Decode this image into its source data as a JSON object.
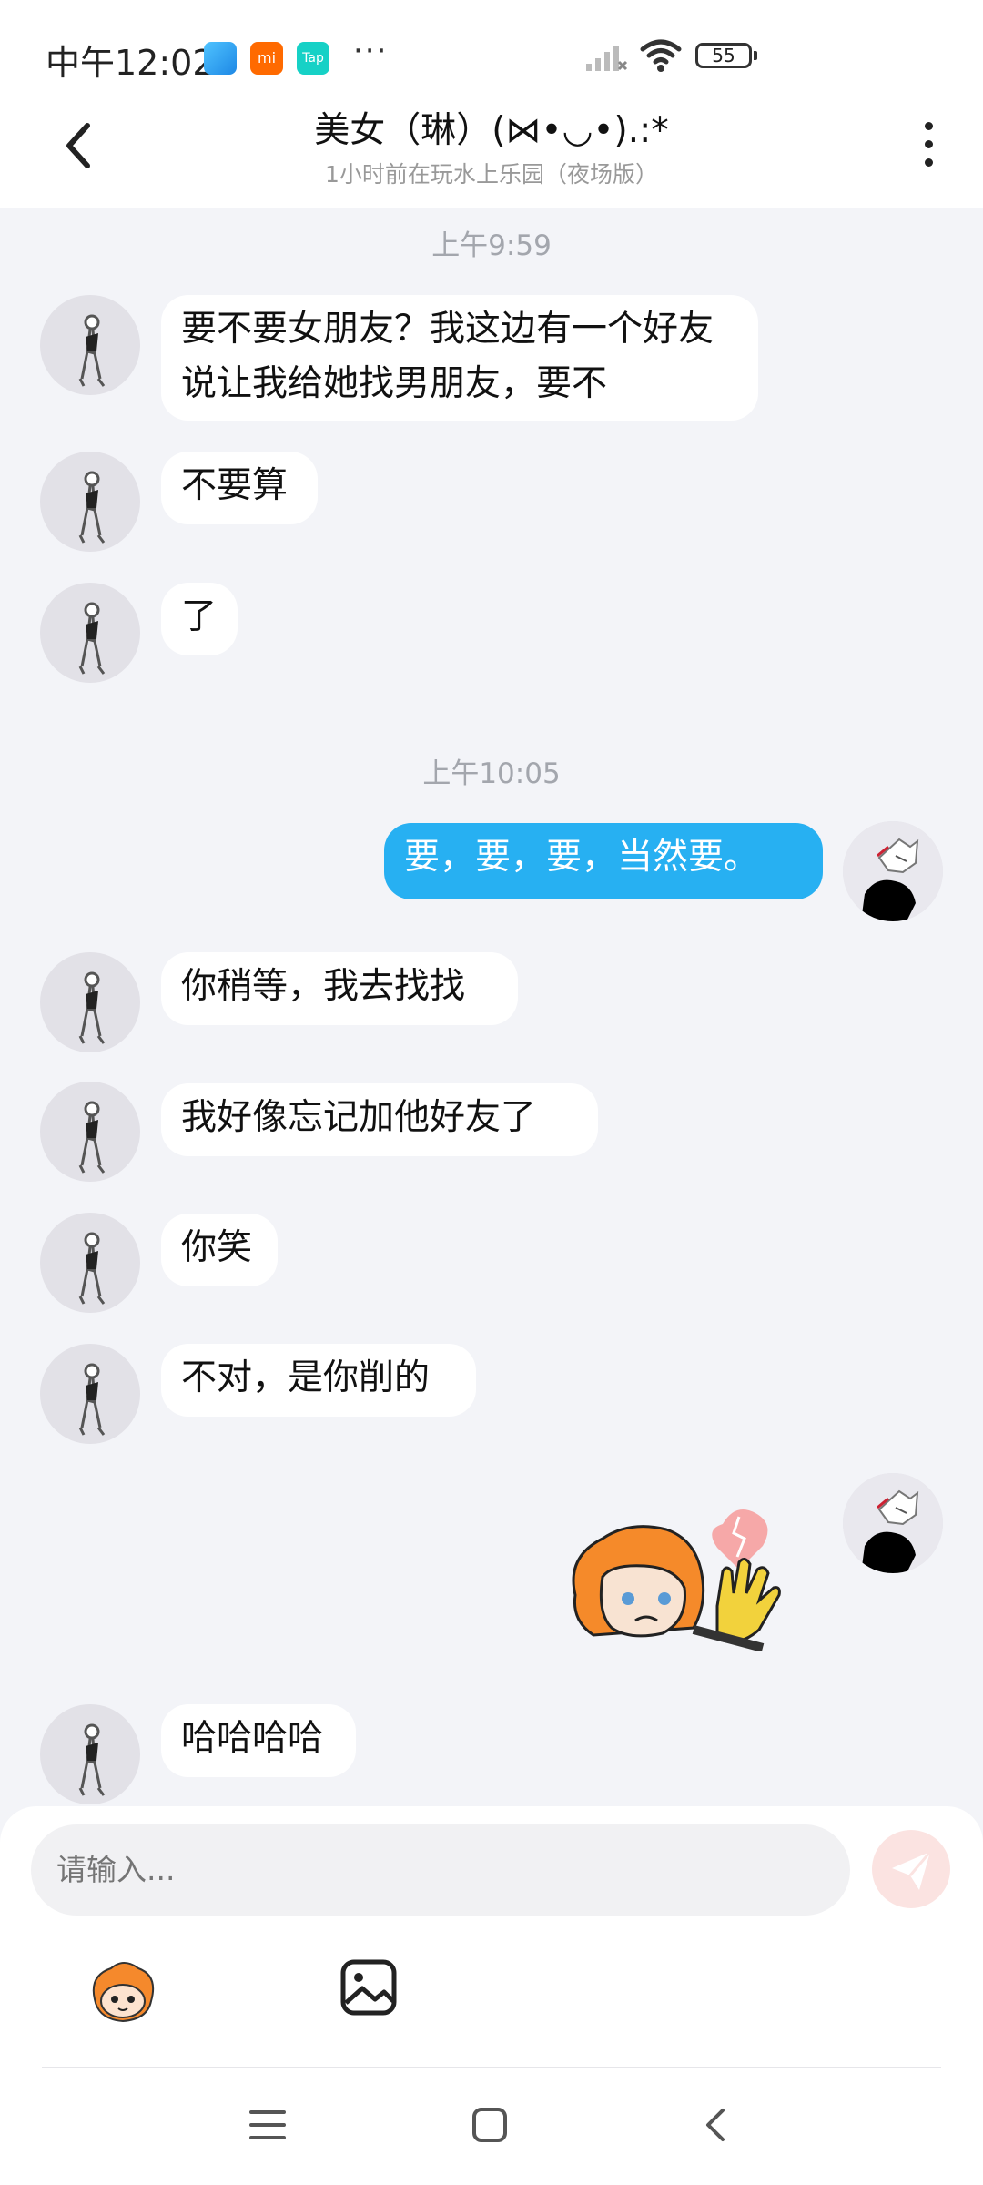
{
  "status_bar": {
    "time": "中午12:02",
    "app_icon_1": "mi-icon",
    "app_icon_1_label": "mi",
    "app_icon_2_label": "Tap",
    "more": "···",
    "battery": "55"
  },
  "header": {
    "title": "美女（琳）(⋈•◡•).:*",
    "subtitle": "1小时前在玩水上乐园（夜场版）"
  },
  "messages": {
    "ts1": "上午9:59",
    "m1": "要不要女朋友？我这边有一个好友说让我给她找男朋友，要不",
    "m2": "不要算",
    "m3": "了",
    "ts2": "上午10:05",
    "m4": "要，要，要，当然要。",
    "m5": "你稍等，我去找找",
    "m6": "我好像忘记加他好友了",
    "m7": "你笑",
    "m8": "不对，是你削的",
    "m10": "哈哈哈哈"
  },
  "input": {
    "placeholder": "请输入..."
  },
  "colors": {
    "accent": "#27b0f2",
    "background": "#f3f4f8",
    "bubble": "#ffffff",
    "send_button": "#fbe3e1"
  }
}
